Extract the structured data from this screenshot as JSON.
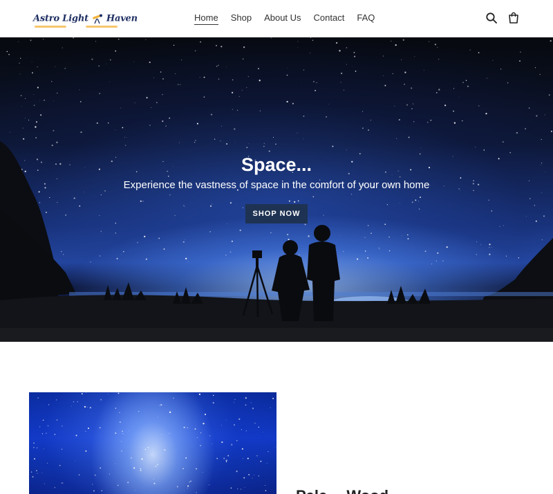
{
  "header": {
    "logo": {
      "word1": "Astro Light",
      "word2": "Haven"
    },
    "nav": [
      {
        "label": "Home",
        "active": true
      },
      {
        "label": "Shop",
        "active": false
      },
      {
        "label": "About Us",
        "active": false
      },
      {
        "label": "Contact",
        "active": false
      },
      {
        "label": "FAQ",
        "active": false
      }
    ],
    "icons": [
      "search-icon",
      "cart-icon"
    ]
  },
  "hero": {
    "title": "Space...",
    "subtitle": "Experience the vastness of space in the comfort of your own home",
    "cta_label": "SHOP NOW",
    "cta_color": "#1e3353"
  },
  "feature": {
    "heading": "Pale… Wood…"
  }
}
